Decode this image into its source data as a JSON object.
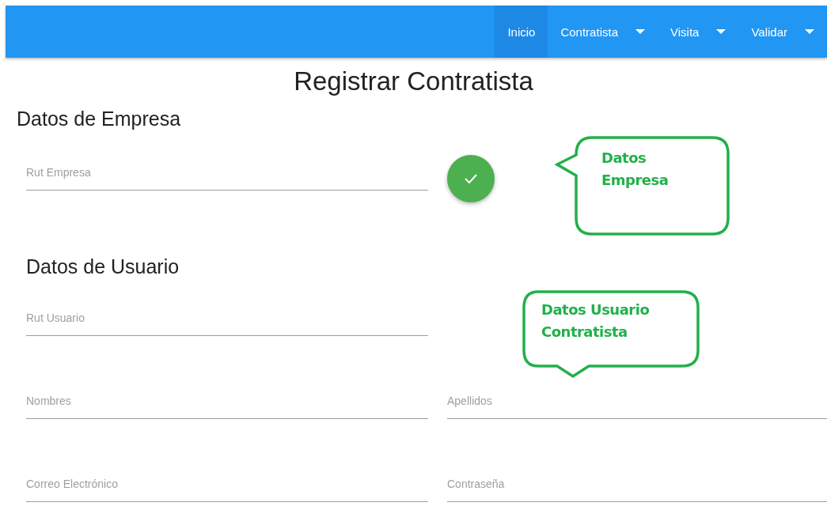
{
  "nav": {
    "items": [
      {
        "label": "Inicio",
        "selected": true,
        "dropdown": false
      },
      {
        "label": "Contratista",
        "selected": false,
        "dropdown": true
      },
      {
        "label": "Visita",
        "selected": false,
        "dropdown": true
      },
      {
        "label": "Validar",
        "selected": false,
        "dropdown": true
      }
    ]
  },
  "title": "Registrar Contratista",
  "company": {
    "heading": "Datos de Empresa",
    "field": {
      "placeholder": "Rut Empresa"
    }
  },
  "user": {
    "heading": "Datos de Usuario",
    "fields": [
      {
        "placeholder": "Rut Usuario"
      },
      {
        "placeholder": "Nombres"
      },
      {
        "placeholder": "Apellidos"
      },
      {
        "placeholder": "Correo Electrónico"
      },
      {
        "placeholder": "Contraseña"
      }
    ]
  },
  "callouts": [
    {
      "text": "Datos Empresa",
      "kind": "left"
    },
    {
      "text": "Datos Usuario Contratista",
      "kind": "bottom"
    }
  ]
}
